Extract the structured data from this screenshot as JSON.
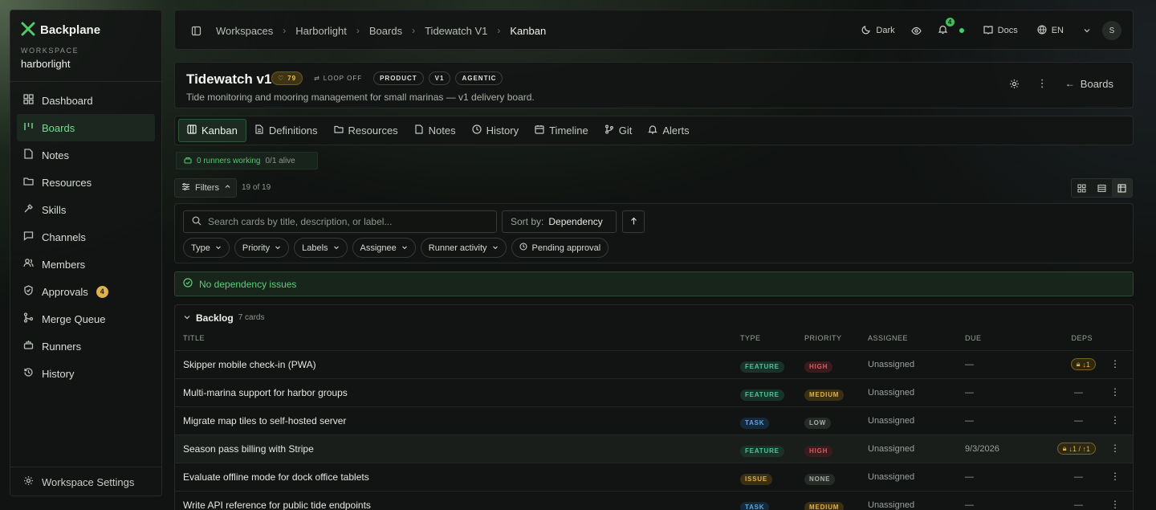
{
  "brand": {
    "name": "Backplane"
  },
  "workspace": {
    "label": "WORKSPACE",
    "name": "harborlight"
  },
  "sidebar": {
    "items": [
      {
        "label": "Dashboard",
        "icon": "dashboard-icon"
      },
      {
        "label": "Boards",
        "icon": "boards-icon",
        "active": true
      },
      {
        "label": "Notes",
        "icon": "notes-icon"
      },
      {
        "label": "Resources",
        "icon": "folder-icon"
      },
      {
        "label": "Skills",
        "icon": "skills-icon"
      },
      {
        "label": "Channels",
        "icon": "chat-icon"
      },
      {
        "label": "Members",
        "icon": "members-icon"
      },
      {
        "label": "Approvals",
        "icon": "shield-icon",
        "badge": "4"
      },
      {
        "label": "Merge Queue",
        "icon": "merge-icon"
      },
      {
        "label": "Runners",
        "icon": "runner-icon"
      },
      {
        "label": "History",
        "icon": "history-icon"
      }
    ],
    "settings_label": "Workspace Settings"
  },
  "topbar": {
    "breadcrumbs": [
      "Workspaces",
      "Harborlight",
      "Boards",
      "Tidewatch V1",
      "Kanban"
    ],
    "theme_label": "Dark",
    "notif_count": "4",
    "docs_label": "Docs",
    "lang_label": "EN",
    "avatar_initial": "S"
  },
  "board": {
    "title": "Tidewatch v1",
    "score": "79",
    "loop": "LOOP OFF",
    "tags": [
      "PRODUCT",
      "V1",
      "AGENTIC"
    ],
    "description": "Tide monitoring and mooring management for small marinas — v1 delivery board.",
    "back_label": "Boards"
  },
  "tabs": [
    {
      "label": "Kanban",
      "icon": "kanban-icon",
      "active": true
    },
    {
      "label": "Definitions",
      "icon": "doc-icon"
    },
    {
      "label": "Resources",
      "icon": "folder-icon"
    },
    {
      "label": "Notes",
      "icon": "notes-icon"
    },
    {
      "label": "History",
      "icon": "history-icon"
    },
    {
      "label": "Timeline",
      "icon": "timeline-icon"
    },
    {
      "label": "Git",
      "icon": "git-icon"
    },
    {
      "label": "Alerts",
      "icon": "bell-icon"
    }
  ],
  "runners": {
    "working": "0 runners working",
    "alive": "0/1 alive"
  },
  "filters": {
    "label": "Filters",
    "count": "19 of 19",
    "search_placeholder": "Search cards by title, description, or label...",
    "sort_prefix": "Sort by:",
    "sort_value": "Dependency",
    "chips": [
      "Type",
      "Priority",
      "Labels",
      "Assignee",
      "Runner activity"
    ],
    "pending_label": "Pending approval"
  },
  "dependency_status": "No dependency issues",
  "backlog": {
    "title": "Backlog",
    "count": "7 cards",
    "columns": {
      "title": "TITLE",
      "type": "TYPE",
      "priority": "PRIORITY",
      "assignee": "ASSIGNEE",
      "due": "DUE",
      "deps": "DEPS"
    },
    "rows": [
      {
        "title": "Skipper mobile check-in (PWA)",
        "type": "FEATURE",
        "priority": "HIGH",
        "assignee": "Unassigned",
        "due": "—",
        "deps": "↓1",
        "deps_locked": true
      },
      {
        "title": "Multi-marina support for harbor groups",
        "type": "FEATURE",
        "priority": "MEDIUM",
        "assignee": "Unassigned",
        "due": "—",
        "deps": "—"
      },
      {
        "title": "Migrate map tiles to self-hosted server",
        "type": "TASK",
        "priority": "LOW",
        "assignee": "Unassigned",
        "due": "—",
        "deps": "—"
      },
      {
        "title": "Season pass billing with Stripe",
        "type": "FEATURE",
        "priority": "HIGH",
        "assignee": "Unassigned",
        "due": "9/3/2026",
        "deps": "↓1 / ↑1",
        "deps_locked": true
      },
      {
        "title": "Evaluate offline mode for dock office tablets",
        "type": "ISSUE",
        "priority": "NONE",
        "assignee": "Unassigned",
        "due": "—",
        "deps": "—"
      },
      {
        "title": "Write API reference for public tide endpoints",
        "type": "TASK",
        "priority": "MEDIUM",
        "assignee": "Unassigned",
        "due": "—",
        "deps": "—"
      }
    ]
  },
  "colors": {
    "accent": "#3fbf5a",
    "warning": "#e0b24c",
    "danger": "#e05a60",
    "info": "#56a8e0"
  }
}
